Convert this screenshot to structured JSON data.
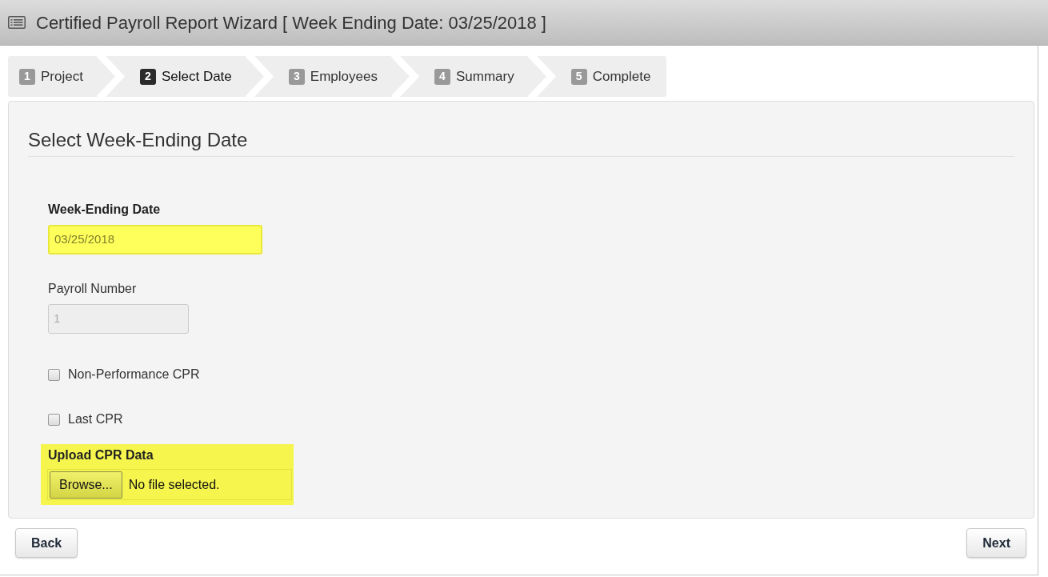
{
  "header": {
    "title": "Certified Payroll Report Wizard [ Week Ending Date: 03/25/2018 ]"
  },
  "steps": [
    {
      "number": "1",
      "label": "Project",
      "selected": false
    },
    {
      "number": "2",
      "label": "Select Date",
      "selected": true
    },
    {
      "number": "3",
      "label": "Employees",
      "selected": false
    },
    {
      "number": "4",
      "label": "Summary",
      "selected": false
    },
    {
      "number": "5",
      "label": "Complete",
      "selected": false
    }
  ],
  "panel": {
    "heading": "Select Week-Ending Date",
    "week_ending_date": {
      "label": "Week-Ending Date",
      "value": "03/25/2018",
      "highlighted": true
    },
    "payroll_number": {
      "label": "Payroll Number",
      "value": "1",
      "disabled": true
    },
    "checkboxes": [
      {
        "label": "Non-Performance CPR",
        "checked": false
      },
      {
        "label": "Last CPR",
        "checked": false
      }
    ],
    "upload": {
      "label": "Upload CPR Data",
      "button": "Browse...",
      "status": "No file selected.",
      "highlighted": true
    }
  },
  "buttons": [
    {
      "kind": "back",
      "label": "Back"
    },
    {
      "kind": "next",
      "label": "Next"
    }
  ]
}
